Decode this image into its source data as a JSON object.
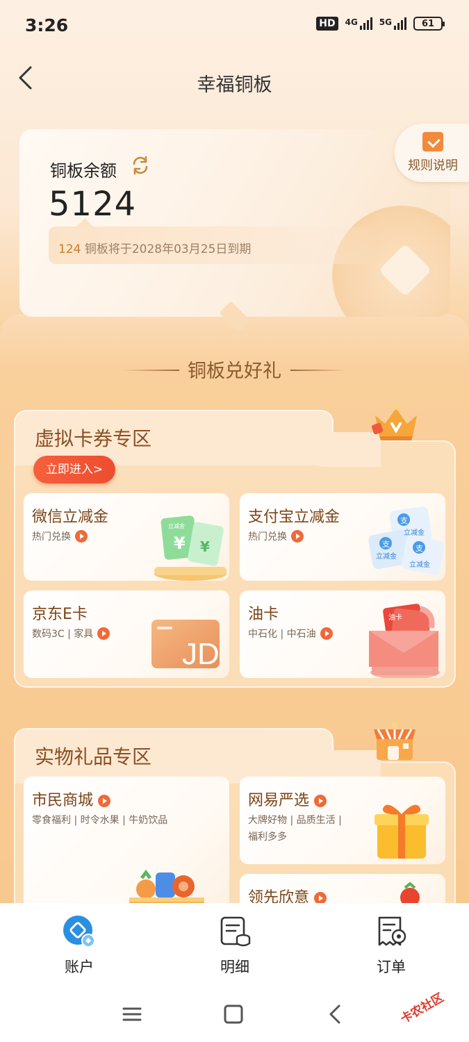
{
  "status_bar": {
    "time": "3:26",
    "hd": "HD",
    "net1": "4G",
    "net2": "5G",
    "battery": "61"
  },
  "header": {
    "title": "幸福铜板"
  },
  "balance": {
    "label": "铜板余额",
    "value": "5124",
    "expire_num": "124",
    "expire_text": " 铜板将于2028年03月25日到期"
  },
  "rules": {
    "label": "规则说明"
  },
  "section": {
    "title": "铜板兑好礼"
  },
  "virtual_zone": {
    "title": "虚拟卡券专区",
    "enter_label": "立即进入>",
    "cards": [
      {
        "title": "微信立减金",
        "sub": "热门兑换"
      },
      {
        "title": "支付宝立减金",
        "sub": "热门兑换"
      },
      {
        "title": "京东E卡",
        "sub": "数码3C | 家具"
      },
      {
        "title": "油卡",
        "sub": "中石化 | 中石油"
      }
    ]
  },
  "physical_zone": {
    "title": "实物礼品专区",
    "cards": [
      {
        "title": "市民商城",
        "sub": "零食福利 | 时令水果 | 牛奶饮品"
      },
      {
        "title": "网易严选",
        "sub": "大牌好物 | 品质生活 |",
        "sub2": "福利多多"
      },
      {
        "title": "领先欣意"
      }
    ]
  },
  "nav": {
    "account": "账户",
    "detail": "明细",
    "order": "订单"
  },
  "illustration_text": {
    "ticket": "立减金",
    "oil_card": "油卡",
    "jd": "JD",
    "alipay_chip": "支",
    "watermark": "卡农社区"
  },
  "colors": {
    "accent": "#ef6a3a",
    "brand_brown": "#8a4f22",
    "nav_blue": "#2a8fe0"
  }
}
